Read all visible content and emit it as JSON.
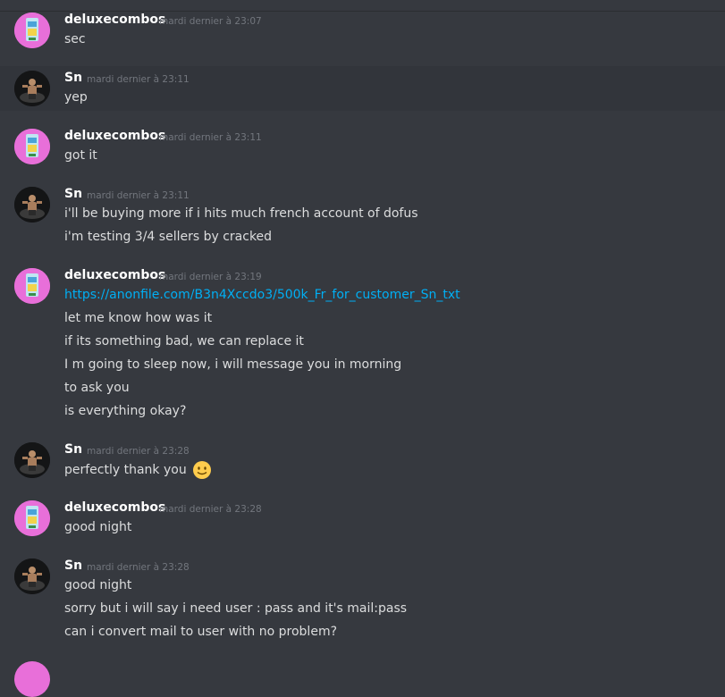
{
  "messages": [
    {
      "author": "deluxecombos",
      "avatar": "deluxecombos-avatar",
      "timestamp": "mardi dernier à 23:07",
      "lines": [
        "sec"
      ]
    },
    {
      "author": "Sn",
      "avatar": "sn-avatar",
      "timestamp": "mardi dernier à 23:11",
      "lines": [
        "yep"
      ]
    },
    {
      "author": "deluxecombos",
      "avatar": "deluxecombos-avatar",
      "timestamp": "mardi dernier à 23:11",
      "lines": [
        "got it"
      ]
    },
    {
      "author": "Sn",
      "avatar": "sn-avatar",
      "timestamp": "mardi dernier à 23:11",
      "lines": [
        "i'll be buying more if i hits much french account of dofus",
        "i'm testing 3/4 sellers by cracked"
      ]
    },
    {
      "author": "deluxecombos",
      "avatar": "deluxecombos-avatar",
      "timestamp": "mardi dernier à 23:19",
      "link": "https://anonfile.com/B3n4Xccdo3/500k_Fr_for_customer_Sn_txt",
      "lines": [
        "let me know how was it",
        "if its something bad, we can replace it",
        "I m going to sleep now, i will message you in morning",
        "to ask you",
        "is everything okay?"
      ]
    },
    {
      "author": "Sn",
      "avatar": "sn-avatar",
      "timestamp": "mardi dernier à 23:28",
      "lines": [
        "perfectly thank you"
      ],
      "emoji": "slightly-smiling-face-emoji"
    },
    {
      "author": "deluxecombos",
      "avatar": "deluxecombos-avatar",
      "timestamp": "mardi dernier à 23:28",
      "lines": [
        "good night"
      ]
    },
    {
      "author": "Sn",
      "avatar": "sn-avatar",
      "timestamp": "mardi dernier à 23:28",
      "lines": [
        "good night",
        "sorry but i will say i need user : pass and it's mail:pass",
        "can i convert mail to user with no problem?"
      ]
    }
  ],
  "colors": {
    "background": "#36393f",
    "username": "#ffffff",
    "text": "#dcddde",
    "timestamp": "#72767d",
    "link": "#00aff4",
    "pink_avatar": "#e86fd9"
  }
}
